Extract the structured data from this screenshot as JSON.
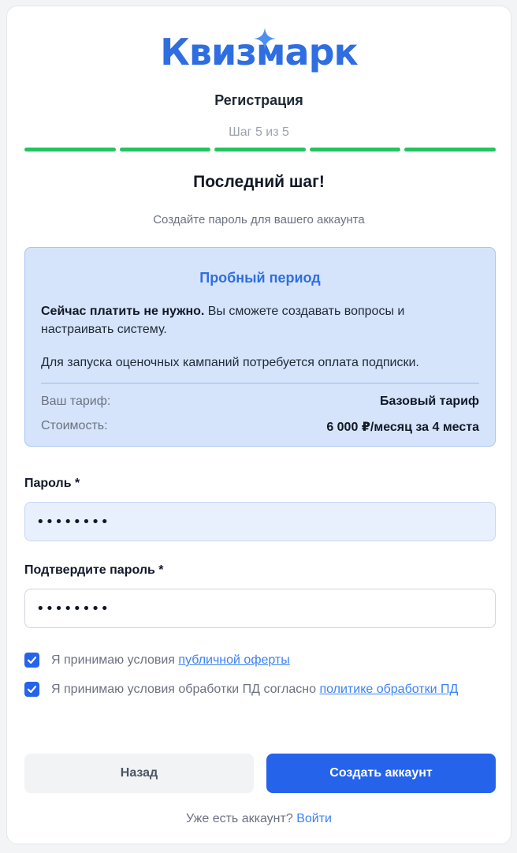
{
  "brand": {
    "name": "Квизмарк",
    "color": "#2f6ee0",
    "sparkle_icon": "sparkle-icon"
  },
  "header": {
    "title": "Регистрация",
    "step_label": "Шаг 5 из 5",
    "steps_total": 5,
    "steps_completed": 5,
    "progress_color": "#22c55e"
  },
  "intro": {
    "title": "Последний шаг!",
    "subtitle": "Создайте пароль для вашего аккаунта"
  },
  "trial": {
    "title": "Пробный период",
    "p1_bold": "Сейчас платить не нужно.",
    "p1_rest": " Вы сможете создавать вопросы и настраивать систему.",
    "p2": "Для запуска оценочных кампаний потребуется оплата подписки.",
    "plan_label": "Ваш тариф:",
    "plan_value": "Базовый тариф",
    "price_label": "Стоимость:",
    "price_value": "6 000 ₽/месяц за 4 места"
  },
  "form": {
    "password_label": "Пароль *",
    "password_value": "••••••••",
    "confirm_label": "Подтвердите пароль *",
    "confirm_value": "••••••••"
  },
  "consents": {
    "offer_text": "Я принимаю условия ",
    "offer_link": "публичной оферты",
    "offer_checked": true,
    "pd_text": "Я принимаю условия обработки ПД согласно ",
    "pd_link": "политике обработки ПД",
    "pd_checked": true
  },
  "actions": {
    "back_label": "Назад",
    "create_label": "Создать аккаунт",
    "accent": "#2563eb"
  },
  "footer": {
    "have_account": "Уже есть аккаунт?",
    "login_link": "Войти"
  }
}
